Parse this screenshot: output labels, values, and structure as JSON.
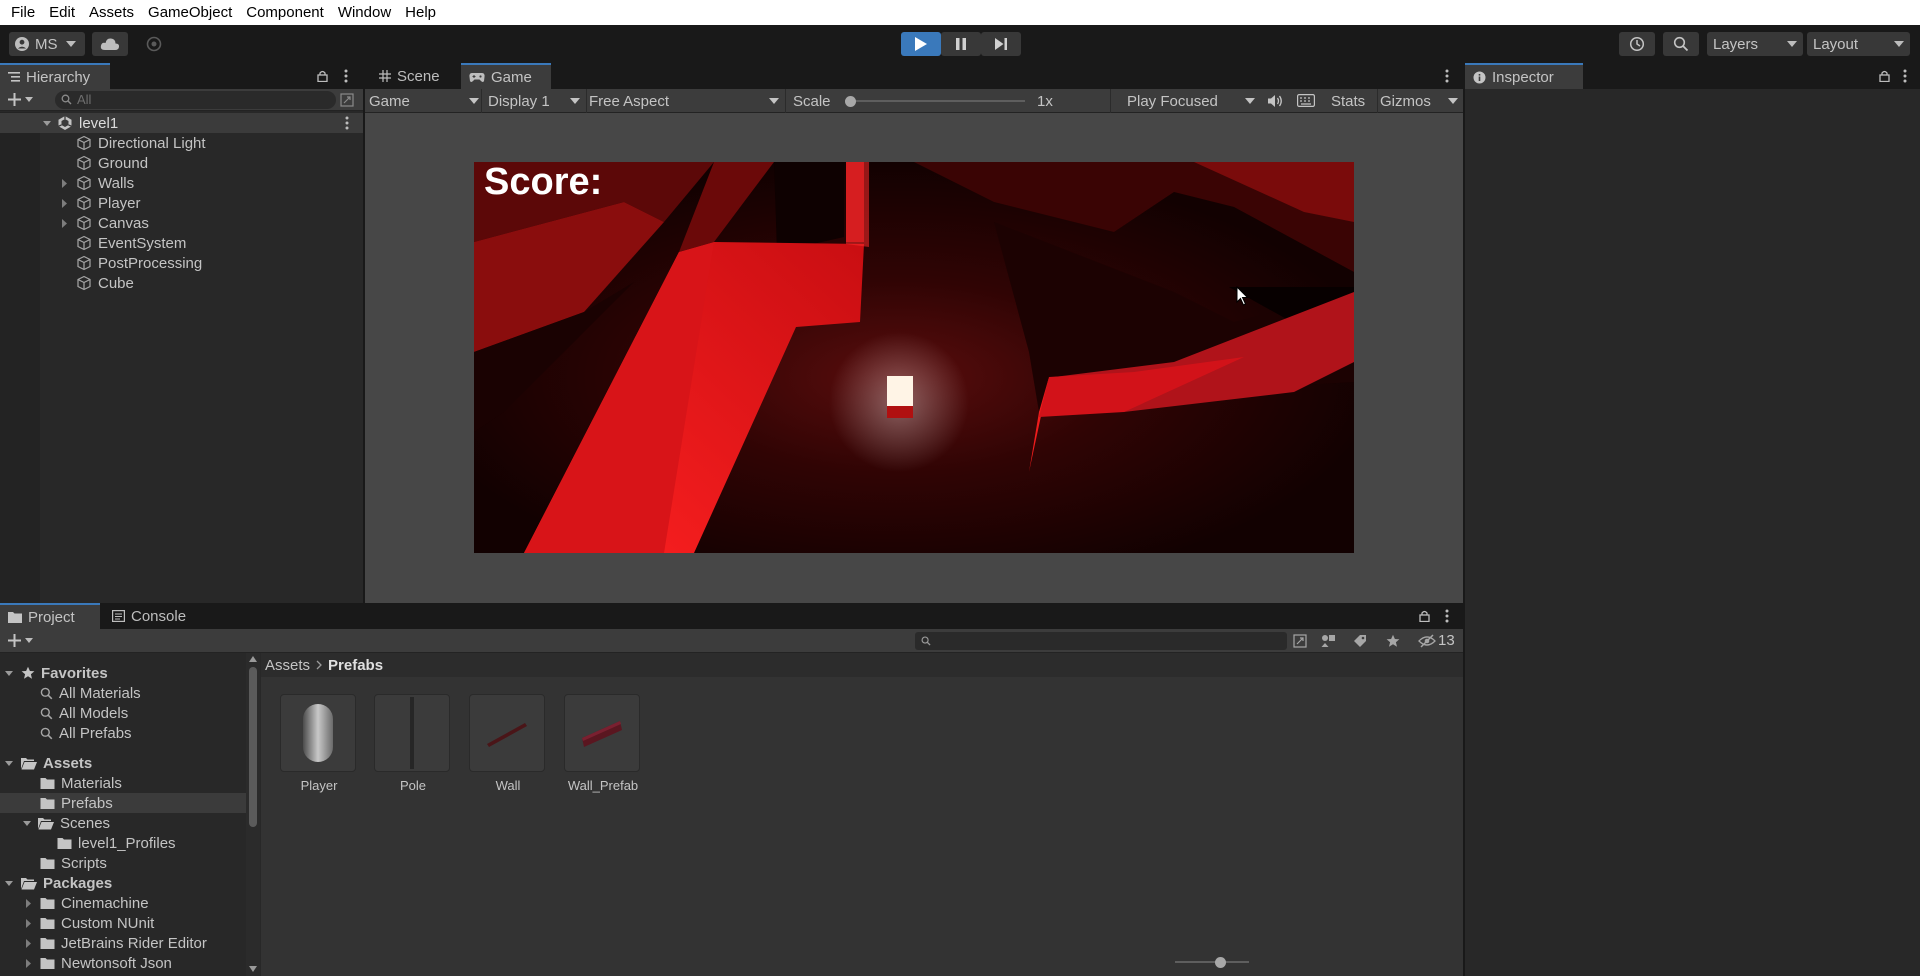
{
  "menu": [
    "File",
    "Edit",
    "Assets",
    "GameObject",
    "Component",
    "Window",
    "Help"
  ],
  "toolbar": {
    "account": "MS",
    "layers": "Layers",
    "layout": "Layout"
  },
  "hierarchy": {
    "tab": "Hierarchy",
    "search_placeholder": "All",
    "scene": "level1",
    "items": [
      "Directional Light",
      "Ground",
      "Walls",
      "Player",
      "Canvas",
      "EventSystem",
      "PostProcessing",
      "Cube"
    ]
  },
  "view": {
    "tabs": [
      "Scene",
      "Game"
    ],
    "game_dropdown": "Game",
    "display": "Display 1",
    "aspect": "Free Aspect",
    "scale_label": "Scale",
    "scale_value": 0.0,
    "scale_text": "1x",
    "play_focused": "Play Focused",
    "stats": "Stats",
    "gizmos": "Gizmos",
    "score": "Score:"
  },
  "inspector": {
    "tab": "Inspector"
  },
  "project": {
    "tabs": [
      "Project",
      "Console"
    ],
    "hidden_count": "13",
    "breadcrumb": [
      "Assets",
      "Prefabs"
    ],
    "favorites_label": "Favorites",
    "favorites": [
      "All Materials",
      "All Models",
      "All Prefabs"
    ],
    "assets_label": "Assets",
    "assets_children": [
      "Materials",
      "Prefabs",
      "Scenes",
      "level1_Profiles",
      "Scripts"
    ],
    "packages_label": "Packages",
    "packages": [
      "Cinemachine",
      "Custom NUnit",
      "JetBrains Rider Editor",
      "Newtonsoft Json"
    ],
    "grid_items": [
      "Player",
      "Pole",
      "Wall",
      "Wall_Prefab"
    ]
  },
  "colors": {
    "accent": "#3a79bb",
    "play_active": "#3a79bb",
    "panel_bg": "#282828",
    "maze_red": "#e8141a"
  }
}
